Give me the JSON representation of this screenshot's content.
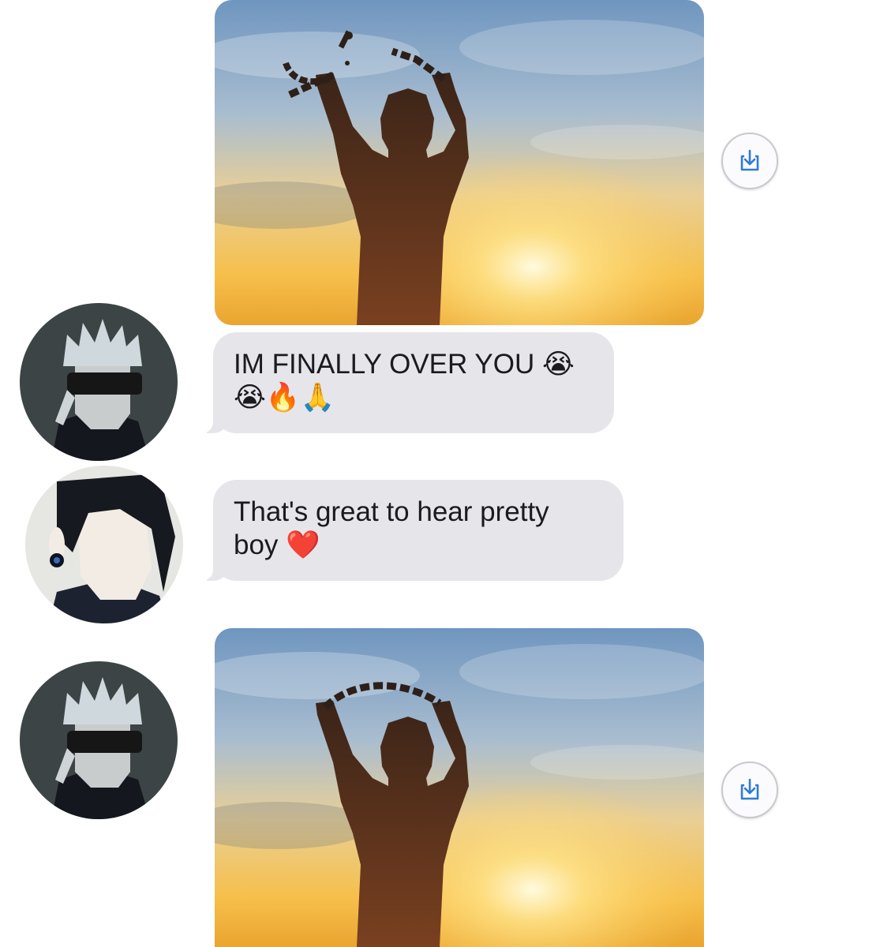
{
  "messages": [
    {
      "type": "image",
      "sender": "gojo",
      "save_icon": "save-download-icon"
    },
    {
      "type": "text",
      "sender": "gojo",
      "text": "IM FINALLY OVER YOU",
      "emoji_inline": "😭",
      "emoji_line2": "😭🔥🙏"
    },
    {
      "type": "text",
      "sender": "geto",
      "text_line1": "That's great to hear pretty",
      "text_line2": "boy",
      "emoji": "❤️"
    },
    {
      "type": "image",
      "sender": "gojo",
      "save_icon": "save-download-icon"
    }
  ],
  "colors": {
    "bubble": "#e6e6ea",
    "accent": "#2f7bd6",
    "background": "#ffffff"
  }
}
